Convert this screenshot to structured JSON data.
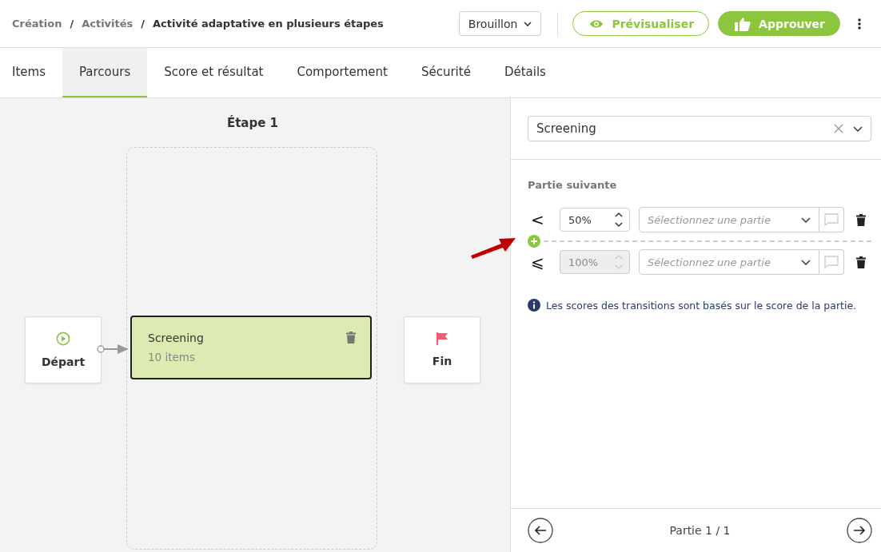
{
  "breadcrumb": [
    {
      "label": "Création",
      "current": false
    },
    {
      "label": "Activités",
      "current": false
    },
    {
      "label": "Activité adaptative en plusieurs étapes",
      "current": true
    }
  ],
  "separator": "/",
  "status_dropdown": {
    "value": "Brouillon"
  },
  "actions": [
    {
      "label": "Prévisualiser",
      "kind": "outline"
    },
    {
      "label": "Approuver",
      "kind": "primary"
    }
  ],
  "tabs": [
    {
      "label": "Items",
      "selected": false
    },
    {
      "label": "Parcours",
      "selected": true
    },
    {
      "label": "Score et résultat",
      "selected": false
    },
    {
      "label": "Comportement",
      "selected": false
    },
    {
      "label": "Sécurité",
      "selected": false
    },
    {
      "label": "Détails",
      "selected": false
    }
  ],
  "canvas": {
    "step_title": "Étape 1",
    "start": {
      "label": "Départ"
    },
    "end": {
      "label": "Fin"
    },
    "parts": [
      {
        "title": "Screening",
        "subtitle": "10 items",
        "selected": true
      }
    ]
  },
  "panel": {
    "part_select": {
      "value": "Screening"
    },
    "section_title": "Partie suivante",
    "transitions": [
      {
        "operator": "<",
        "value": "50%",
        "disabled": false,
        "placeholder": "Sélectionnez une partie"
      },
      {
        "operator": "⩽",
        "value": "100%",
        "disabled": true,
        "placeholder": "Sélectionnez une partie"
      }
    ],
    "info": "Les scores des transitions sont basés sur le score de la partie.",
    "pager": "Partie 1 / 1"
  }
}
